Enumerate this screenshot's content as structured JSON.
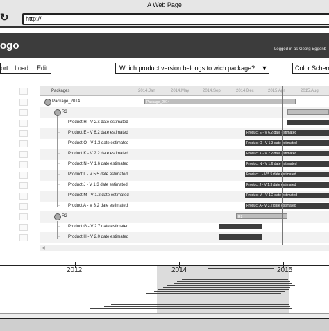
{
  "window": {
    "title": "A Web Page",
    "url": "http://"
  },
  "header": {
    "logo": "ogo",
    "logged_in": "Logged in as Georg Eggenb"
  },
  "menu": {
    "items": [
      "ort",
      "Load",
      "Edit"
    ]
  },
  "version_select": {
    "value": "Which product version belongs to wich package?"
  },
  "color_scheme": {
    "label": "Color Scheme"
  },
  "gantt": {
    "column_header": "Packages",
    "ticks": [
      "2014,Jan",
      "2014,May",
      "2014,Sep",
      "2014,Dec",
      "2015,Apr",
      "2015,Aug"
    ],
    "rows": [
      {
        "label": "Package_2014",
        "level": 0,
        "node": true,
        "bar": {
          "type": "light",
          "text": "Package_2014"
        }
      },
      {
        "label": "R3",
        "level": 1,
        "node": true,
        "bar": {
          "type": "light",
          "text": ""
        }
      },
      {
        "label": "Product H - V 2.x date estimated",
        "level": 2,
        "bar": {
          "type": "dark",
          "text": ""
        }
      },
      {
        "label": "Product E - V 6.2 date estimated",
        "level": 2,
        "bar": {
          "type": "dark",
          "text": "Product E - V 6.2 date estimated"
        }
      },
      {
        "label": "Product O - V 1.3 date estimated",
        "level": 2,
        "bar": {
          "type": "dark",
          "text": "Product O - V 1.3 date estimated"
        }
      },
      {
        "label": "Product K - V 2.2 date estimated",
        "level": 2,
        "bar": {
          "type": "dark",
          "text": "Product K - V 2.2 date estimated"
        }
      },
      {
        "label": "Product N - V 1.6 date estimated",
        "level": 2,
        "bar": {
          "type": "dark",
          "text": "Product N - V 1.6 date estimated"
        }
      },
      {
        "label": "Product L - V 5.5 date estimated",
        "level": 2,
        "bar": {
          "type": "dark",
          "text": "Product L - V 5.5 date estimated"
        }
      },
      {
        "label": "Product J - V 1.3 date estimated",
        "level": 2,
        "bar": {
          "type": "dark",
          "text": "Product J - V 1.3 date estimated"
        }
      },
      {
        "label": "Product M - V 1.2 date estimated",
        "level": 2,
        "bar": {
          "type": "dark",
          "text": "Product M - V 1.2 date estimated"
        }
      },
      {
        "label": "Product A - V 3.2 date estimated",
        "level": 2,
        "bar": {
          "type": "dark",
          "text": "Product A - V 3.2 date estimated"
        }
      },
      {
        "label": "R2",
        "level": 1,
        "node": true,
        "bar": {
          "type": "light",
          "text": "R2"
        }
      },
      {
        "label": "Product G - V 2.7 date estimated",
        "level": 2,
        "bar": {
          "type": "dark",
          "text": ""
        }
      },
      {
        "label": "Product H - V 2.0 date estimated",
        "level": 2,
        "bar": {
          "type": "dark",
          "text": ""
        }
      }
    ]
  },
  "overview": {
    "labels": [
      "2012",
      "2014",
      "2015"
    ]
  }
}
